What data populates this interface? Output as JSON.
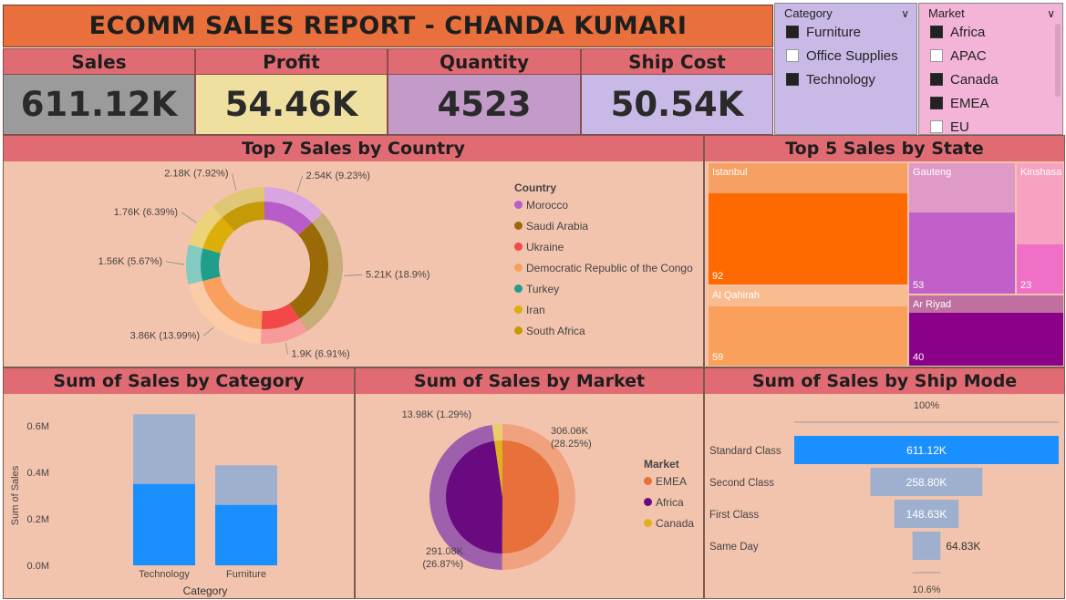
{
  "header": {
    "title": "ECOMM SALES REPORT - CHANDA KUMARI"
  },
  "kpis": [
    {
      "label": "Sales",
      "value": "611.12K",
      "color": "#9b9b9b"
    },
    {
      "label": "Profit",
      "value": "54.46K",
      "color": "#f0e0a0"
    },
    {
      "label": "Quantity",
      "value": "4523",
      "color": "#c39bc9"
    },
    {
      "label": "Ship Cost",
      "value": "50.54K",
      "color": "#c9b9e6"
    }
  ],
  "slicers": {
    "category": {
      "title": "Category",
      "items": [
        {
          "label": "Furniture",
          "checked": true
        },
        {
          "label": "Office Supplies",
          "checked": false
        },
        {
          "label": "Technology",
          "checked": true
        }
      ]
    },
    "market": {
      "title": "Market",
      "items": [
        {
          "label": "Africa",
          "checked": true
        },
        {
          "label": "APAC",
          "checked": false
        },
        {
          "label": "Canada",
          "checked": true
        },
        {
          "label": "EMEA",
          "checked": true
        },
        {
          "label": "EU",
          "checked": false
        }
      ]
    }
  },
  "country_chart": {
    "title": "Top 7 Sales by Country",
    "legend_title": "Country",
    "chart_data": {
      "type": "pie",
      "categories": [
        "Morocco",
        "Saudi Arabia",
        "Ukraine",
        "Democratic Republic of the Congo",
        "Turkey",
        "Iran",
        "South Africa"
      ],
      "values": [
        2.54,
        5.21,
        1.9,
        3.86,
        1.56,
        1.76,
        2.18
      ],
      "unit": "K",
      "labels": [
        "2.54K (9.23%)",
        "5.21K (18.9%)",
        "1.9K (6.91%)",
        "3.86K (13.99%)",
        "1.56K (5.67%)",
        "1.76K (6.39%)",
        "2.18K (7.92%)"
      ],
      "colors": [
        "#b85cc9",
        "#9a6a08",
        "#f24848",
        "#f9a060",
        "#1f9e8c",
        "#dcae0a",
        "#c49a06"
      ]
    }
  },
  "state_chart": {
    "title": "Top 5 Sales by State",
    "chart_data": {
      "type": "treemap",
      "categories": [
        "Istanbul",
        "Gauteng",
        "Kinshasa",
        "Al Qahirah",
        "Ar Riyad"
      ],
      "values": [
        92,
        53,
        23,
        59,
        40
      ]
    }
  },
  "category_chart": {
    "title": "Sum of Sales by Category",
    "chart_data": {
      "type": "bar",
      "categories": [
        "Technology",
        "Furniture"
      ],
      "values": [
        0.35,
        0.26
      ],
      "totals": [
        0.65,
        0.43
      ],
      "xlabel": "Category",
      "ylabel": "Sum of Sales",
      "ylim": [
        0,
        0.6
      ],
      "ticks": [
        "0.0M",
        "0.2M",
        "0.4M",
        "0.6M"
      ]
    }
  },
  "market_chart": {
    "title": "Sum of Sales by Market",
    "legend_title": "Market",
    "chart_data": {
      "type": "pie",
      "categories": [
        "EMEA",
        "Africa",
        "Canada"
      ],
      "values": [
        306.06,
        291.08,
        13.98
      ],
      "unit": "K",
      "labels": [
        "306.06K\n(28.25%)",
        "291.08K\n(26.87%)",
        "13.98K (1.29%)"
      ],
      "colors": [
        "#e8703a",
        "#6a0a80",
        "#e0b020"
      ]
    }
  },
  "shipmode_chart": {
    "title": "Sum of Sales by Ship Mode",
    "top_pct": "100%",
    "bottom_pct": "10.6%",
    "chart_data": {
      "type": "bar",
      "categories": [
        "Standard Class",
        "Second Class",
        "First Class",
        "Same Day"
      ],
      "values": [
        611.12,
        258.8,
        148.63,
        64.83
      ],
      "labels": [
        "611.12K",
        "258.80K",
        "148.63K",
        "64.83K"
      ]
    }
  }
}
